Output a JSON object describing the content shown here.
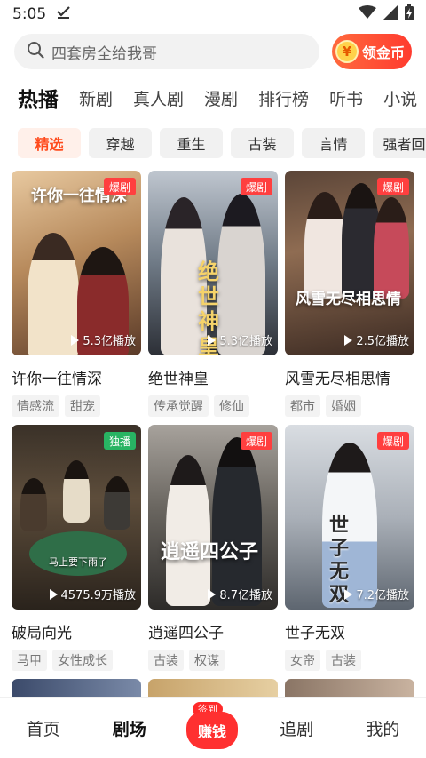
{
  "status_bar": {
    "time": "5:05"
  },
  "search": {
    "placeholder": "四套房全给我哥"
  },
  "coin_button": {
    "label": "领金币",
    "icon_glyph": "¥"
  },
  "tabs": [
    {
      "label": "热播",
      "active": true
    },
    {
      "label": "新剧"
    },
    {
      "label": "真人剧"
    },
    {
      "label": "漫剧"
    },
    {
      "label": "排行榜"
    },
    {
      "label": "听书"
    },
    {
      "label": "小说"
    }
  ],
  "chips": [
    {
      "label": "精选",
      "active": true
    },
    {
      "label": "穿越"
    },
    {
      "label": "重生"
    },
    {
      "label": "古装"
    },
    {
      "label": "言情"
    },
    {
      "label": "强者回"
    }
  ],
  "cards": [
    {
      "title": "许你一往情深",
      "badge": "爆剧",
      "plays": "5.3亿播放",
      "poster_text": "许你一往情深",
      "tags": [
        "情感流",
        "甜宠"
      ]
    },
    {
      "title": "绝世神皇",
      "badge": "爆剧",
      "plays": "5.3亿播放",
      "poster_text": "绝世神皇",
      "tags": [
        "传承觉醒",
        "修仙"
      ]
    },
    {
      "title": "风雪无尽相思情",
      "badge": "爆剧",
      "plays": "2.5亿播放",
      "poster_text": "风雪无尽相思情",
      "tags": [
        "都市",
        "婚姻"
      ]
    },
    {
      "title": "破局向光",
      "badge": "独播",
      "plays": "4575.9万播放",
      "poster_text": "马上要下雨了",
      "tags": [
        "马甲",
        "女性成长"
      ]
    },
    {
      "title": "逍遥四公子",
      "badge": "爆剧",
      "plays": "8.7亿播放",
      "poster_text": "逍遥四公子",
      "tags": [
        "古装",
        "权谋"
      ]
    },
    {
      "title": "世子无双",
      "badge": "爆剧",
      "plays": "7.2亿播放",
      "poster_text": "世子无双",
      "tags": [
        "女帝",
        "古装"
      ]
    }
  ],
  "bottom_nav": {
    "home": "首页",
    "theater": "剧场",
    "earn": "赚钱",
    "sign_in": "签到",
    "follow": "追剧",
    "mine": "我的"
  },
  "colors": {
    "accent": "#ff4a1c",
    "badge_hot": "#ff3f3f",
    "badge_exclusive": "#28b463"
  }
}
